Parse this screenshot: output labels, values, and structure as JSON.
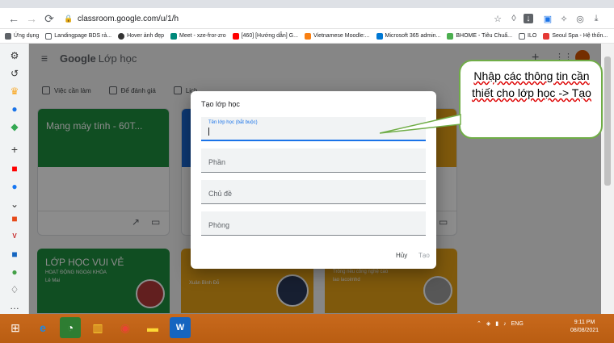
{
  "browser": {
    "url": "classroom.google.com/u/1/h",
    "bookmarks": [
      {
        "label": "Ứng dụng",
        "color": "#5f6368"
      },
      {
        "label": "Landingpage BDS rả...",
        "color": "#5f6368"
      },
      {
        "label": "Hover ảnh đẹp",
        "color": "#333333"
      },
      {
        "label": "Meet - xze-fror-zro",
        "color": "#00897b"
      },
      {
        "label": "[460] [Hướng dẫn] G...",
        "color": "#ff0000"
      },
      {
        "label": "Vietnamese Moodle:...",
        "color": "#f98012"
      },
      {
        "label": "Microsoft 365 admin...",
        "color": "#0078d4"
      },
      {
        "label": "BHOME - Tiêu Chuẩ...",
        "color": "#4caf50"
      },
      {
        "label": "ILO",
        "color": "#5f6368"
      },
      {
        "label": "Seoul Spa - Hệ thốn...",
        "color": "#e53935"
      },
      {
        "label": "»",
        "color": "#5f6368"
      }
    ]
  },
  "classroom": {
    "logo_google": "Google",
    "logo_product": "Lớp học",
    "subnav": [
      "Việc cần làm",
      "Để đánh giá",
      "Lịch"
    ],
    "cards": [
      {
        "title": "Mạng máy tính - 60T...",
        "color": "#1e8e3e"
      },
      {
        "title": "",
        "color": "#1967d2"
      },
      {
        "title": "",
        "color": "#e8a317"
      }
    ],
    "cards_row2": [
      {
        "title": "LỚP HỌC VUI VẺ",
        "subtitle": "HOẠT ĐỘNG NGOẠI KHÓA",
        "teacher": "Lê Mai",
        "color": "#1e8e3e"
      },
      {
        "title": "",
        "subtitle": "",
        "teacher": "Xuân Bình Đỗ",
        "color": "#e8a317"
      },
      {
        "title": "",
        "subtitle": "Trông nêu công nghệ cao",
        "teacher": "lao lacoimhd",
        "color": "#e8a317"
      }
    ]
  },
  "dialog": {
    "title": "Tạo lớp học",
    "fields": [
      {
        "label": "Tên lớp học (bắt buộc)",
        "placeholder": ""
      },
      {
        "label": "",
        "placeholder": "Phần"
      },
      {
        "label": "",
        "placeholder": "Chủ đề"
      },
      {
        "label": "",
        "placeholder": "Phòng"
      }
    ],
    "cancel": "Hủy",
    "create": "Tạo"
  },
  "callout": {
    "text": "Nhập các thông tin cần thiết cho lớp học -> Tạo"
  },
  "taskbar": {
    "lang": "ENG",
    "time": "9:11 PM",
    "date": "08/08/2021"
  }
}
